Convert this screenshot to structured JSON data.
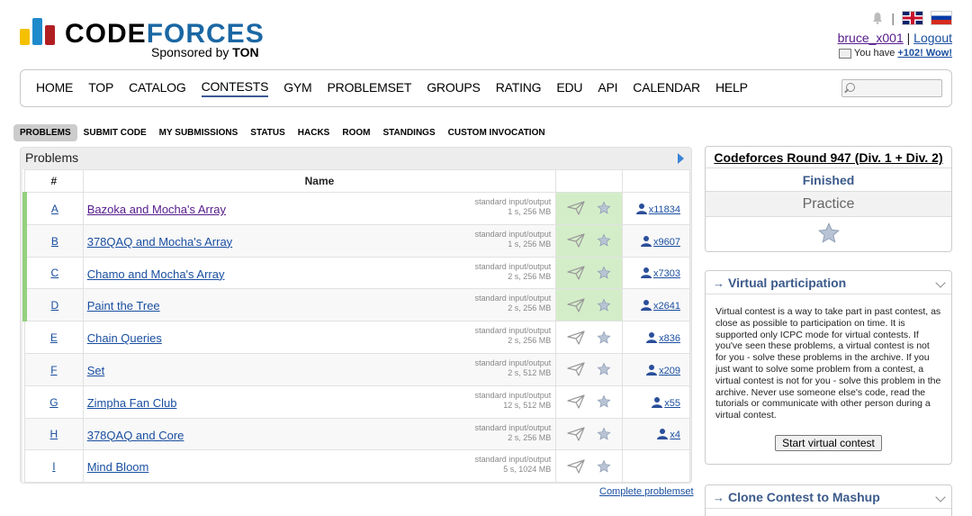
{
  "header": {
    "logo_code": "CODE",
    "logo_forces": "FORCES",
    "sponsor_prefix": "Sponsored by",
    "sponsor_name": "TON",
    "separator": "|",
    "username": "bruce_x001",
    "user_sep": "|",
    "logout": "Logout",
    "msg_prefix": "You have",
    "msg_count": "+102! Wow!"
  },
  "main_menu": [
    "HOME",
    "TOP",
    "CATALOG",
    "CONTESTS",
    "GYM",
    "PROBLEMSET",
    "GROUPS",
    "RATING",
    "EDU",
    "API",
    "CALENDAR",
    "HELP"
  ],
  "main_menu_active": "CONTESTS",
  "search": {
    "value": "",
    "placeholder": ""
  },
  "second_menu": [
    "PROBLEMS",
    "SUBMIT CODE",
    "MY SUBMISSIONS",
    "STATUS",
    "HACKS",
    "ROOM",
    "STANDINGS",
    "CUSTOM INVOCATION"
  ],
  "second_menu_active": "PROBLEMS",
  "problems": {
    "caption": "Problems",
    "col_index": "#",
    "col_name": "Name",
    "rows": [
      {
        "idx": "A",
        "name": "Bazoka and Mocha's Array",
        "io": "standard input/output",
        "limits": "1 s, 256 MB",
        "solved": "x11834",
        "accepted": true
      },
      {
        "idx": "B",
        "name": "378QAQ and Mocha's Array",
        "io": "standard input/output",
        "limits": "1 s, 256 MB",
        "solved": "x9607",
        "accepted": true
      },
      {
        "idx": "C",
        "name": "Chamo and Mocha's Array",
        "io": "standard input/output",
        "limits": "2 s, 256 MB",
        "solved": "x7303",
        "accepted": true
      },
      {
        "idx": "D",
        "name": "Paint the Tree",
        "io": "standard input/output",
        "limits": "2 s, 256 MB",
        "solved": "x2641",
        "accepted": true
      },
      {
        "idx": "E",
        "name": "Chain Queries",
        "io": "standard input/output",
        "limits": "2 s, 256 MB",
        "solved": "x836",
        "accepted": false
      },
      {
        "idx": "F",
        "name": "Set",
        "io": "standard input/output",
        "limits": "2 s, 512 MB",
        "solved": "x209",
        "accepted": false
      },
      {
        "idx": "G",
        "name": "Zimpha Fan Club",
        "io": "standard input/output",
        "limits": "12 s, 512 MB",
        "solved": "x55",
        "accepted": false
      },
      {
        "idx": "H",
        "name": "378QAQ and Core",
        "io": "standard input/output",
        "limits": "2 s, 256 MB",
        "solved": "x4",
        "accepted": false
      },
      {
        "idx": "I",
        "name": "Mind Bloom",
        "io": "standard input/output",
        "limits": "5 s, 1024 MB",
        "solved": "",
        "accepted": false
      }
    ],
    "complete_link": "Complete problemset"
  },
  "sidebar": {
    "round_title": "Codeforces Round 947 (Div. 1 + Div. 2)",
    "round_status": "Finished",
    "round_practice": "Practice",
    "vp_title": "Virtual participation",
    "vp_arrow": "→",
    "vp_text": "Virtual contest is a way to take part in past contest, as close as possible to participation on time. It is supported only ICPC mode for virtual contests. If you've seen these problems, a virtual contest is not for you - solve these problems in the archive. If you just want to solve some problem from a contest, a virtual contest is not for you - solve this problem in the archive. Never use someone else's code, read the tutorials or communicate with other person during a virtual contest.",
    "vp_button": "Start virtual contest",
    "clone_title": "Clone Contest to Mashup",
    "clone_arrow": "→"
  },
  "colors": {
    "accepted": "#95d07f",
    "accepted_cell": "#d4edc9",
    "link": "#1a4fa0",
    "brand_blue": "#1a67a4"
  }
}
